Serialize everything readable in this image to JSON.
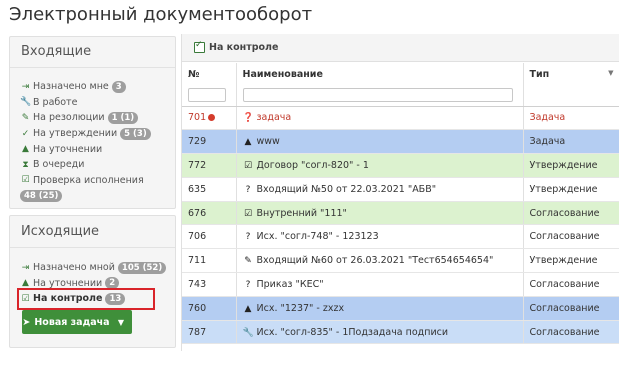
{
  "page": {
    "title": "Электронный документооборот"
  },
  "inbox": {
    "title": "Входящие",
    "items": [
      {
        "icon": "arrow-in-icon",
        "glyph": "⇥",
        "label": "Назначено мне",
        "badge": "3"
      },
      {
        "icon": "wrench-icon",
        "glyph": "🔧",
        "label": "В работе",
        "badge": ""
      },
      {
        "icon": "pen-icon",
        "glyph": "✎",
        "label": "На резолюции",
        "badge": "1 (1)"
      },
      {
        "icon": "check-circle-icon",
        "glyph": "✓",
        "label": "На утверждении",
        "badge": "5 (3)"
      },
      {
        "icon": "warning-icon",
        "glyph": "▲",
        "label": "На уточнении",
        "badge": ""
      },
      {
        "icon": "hourglass-icon",
        "glyph": "⧗",
        "label": "В очереди",
        "badge": ""
      },
      {
        "icon": "checkbox-icon",
        "glyph": "☑",
        "label": "Проверка исполнения",
        "badge": ""
      },
      {
        "icon": "",
        "glyph": "",
        "label": "",
        "badge": "48 (25)"
      }
    ]
  },
  "outbox": {
    "title": "Исходящие",
    "items": [
      {
        "icon": "arrow-out-icon",
        "glyph": "⇥",
        "label": "Назначено мной",
        "badge": "105 (52)"
      },
      {
        "icon": "warning-icon",
        "glyph": "▲",
        "label": "На уточнении",
        "badge": "2"
      },
      {
        "icon": "checkbox-icon",
        "glyph": "☑",
        "label": "На контроле",
        "badge": "13"
      }
    ],
    "new_task_button": "Новая задача"
  },
  "grid": {
    "toolbar_label": "На контроле",
    "columns": [
      "№",
      "Наименование",
      "Тип"
    ],
    "rows": [
      {
        "style": "red",
        "num": "701",
        "icon": "question-icon",
        "glyph": "❓",
        "name": "задача",
        "type": "Задача"
      },
      {
        "style": "blue",
        "num": "729",
        "icon": "warning-icon",
        "glyph": "▲",
        "name": "www",
        "type": "Задача"
      },
      {
        "style": "green",
        "num": "772",
        "icon": "checkbox-icon",
        "glyph": "☑",
        "name": "Договор \"согл-820\" - 1",
        "type": "Утверждение"
      },
      {
        "style": "white",
        "num": "635",
        "icon": "question-icon",
        "glyph": "?",
        "name": "Входящий №50 от 22.03.2021 \"АБВ\"",
        "type": "Утверждение"
      },
      {
        "style": "green",
        "num": "676",
        "icon": "checkbox-icon",
        "glyph": "☑",
        "name": "Внутренний \"111\"",
        "type": "Согласование"
      },
      {
        "style": "white",
        "num": "706",
        "icon": "question-icon",
        "glyph": "?",
        "name": "Исх. \"согл-748\" - 123123",
        "type": "Согласование"
      },
      {
        "style": "white",
        "num": "711",
        "icon": "pen-icon",
        "glyph": "✎",
        "name": "Входящий №60 от 26.03.2021 \"Тест654654654\"",
        "type": "Утверждение"
      },
      {
        "style": "white",
        "num": "743",
        "icon": "question-icon",
        "glyph": "?",
        "name": "Приказ \"КЕС\"",
        "type": "Согласование"
      },
      {
        "style": "blue",
        "num": "760",
        "icon": "warning-icon",
        "glyph": "▲",
        "name": "Исх. \"1237\" - zxzx",
        "type": "Согласование"
      },
      {
        "style": "lblue",
        "num": "787",
        "icon": "wrench-icon",
        "glyph": "🔧",
        "name": "Исх. \"согл-835\" - 1Подзадача подписи",
        "type": "Согласование"
      }
    ]
  }
}
